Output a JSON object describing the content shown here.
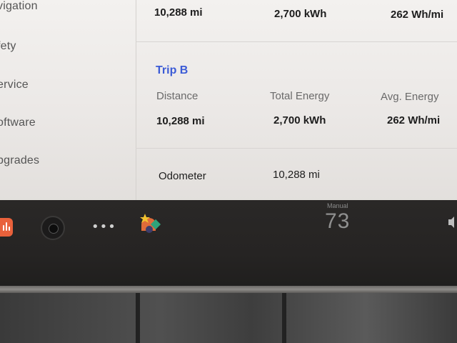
{
  "sidebar": {
    "items": [
      {
        "label": "vigation"
      },
      {
        "label": "fety"
      },
      {
        "label": "ervice"
      },
      {
        "label": "oftware"
      },
      {
        "label": "pgrades"
      }
    ]
  },
  "trip_a": {
    "distance": "10,288 mi",
    "total_energy": "2,700 kWh",
    "avg_energy": "262 Wh/mi"
  },
  "trip_b": {
    "title": "Trip B",
    "headers": {
      "distance": "Distance",
      "total_energy": "Total Energy",
      "avg_energy": "Avg. Energy"
    },
    "distance": "10,288 mi",
    "total_energy": "2,700 kWh",
    "avg_energy": "262 Wh/mi"
  },
  "odometer": {
    "label": "Odometer",
    "value": "10,288 mi"
  },
  "taskbar": {
    "icons": [
      "music-icon",
      "camera-icon",
      "more-dots-icon",
      "toybox-icon",
      "volume-icon"
    ],
    "dots": "•••",
    "climate": {
      "mode": "Manual",
      "temperature": "73"
    }
  },
  "colors": {
    "accent": "#3b5bd6",
    "music_app": "#e9613b"
  }
}
